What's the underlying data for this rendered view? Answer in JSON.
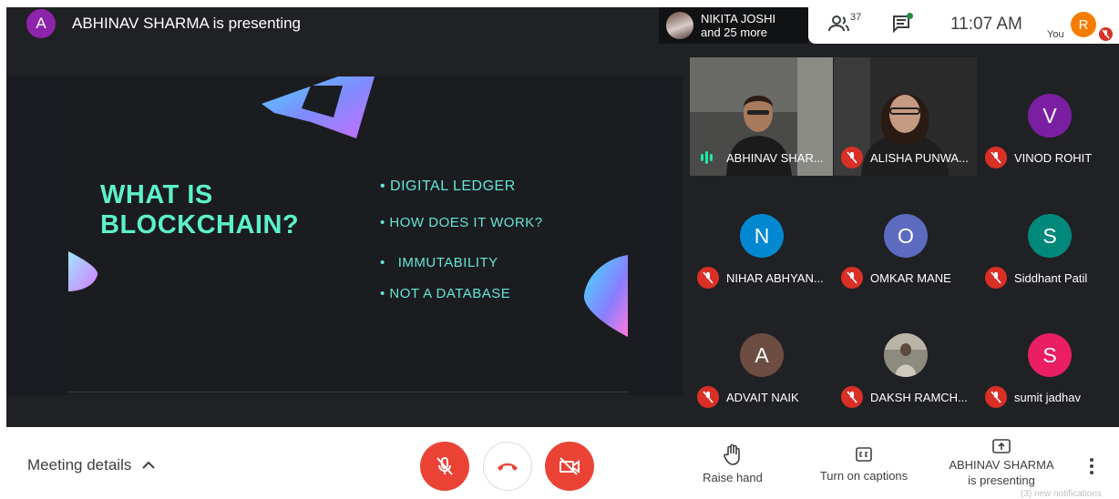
{
  "presenter": {
    "avatar_initial": "A",
    "banner_text": "ABHINAV SHARMA is presenting"
  },
  "top_chip": {
    "line1": "NIKITA JOSHI",
    "line2": "and 25 more"
  },
  "status": {
    "people_count": "37",
    "time": "11:07 AM",
    "you_label": "You",
    "you_initial": "R"
  },
  "slide": {
    "title_line1": "WHAT IS",
    "title_line2": "BLOCKCHAIN?",
    "bullets": [
      "• DIGITAL LEDGER",
      "• HOW DOES IT WORK?",
      "•   IMMUTABILITY",
      "• NOT A DATABASE"
    ]
  },
  "participants": [
    {
      "name": "ABHINAV SHAR...",
      "initial": "",
      "color": "",
      "muted": false,
      "speaking": true
    },
    {
      "name": "ALISHA PUNWA...",
      "initial": "",
      "color": "",
      "muted": true
    },
    {
      "name": "VINOD ROHIT",
      "initial": "V",
      "color": "#7b1fa2",
      "muted": true
    },
    {
      "name": "NIHAR ABHYAN...",
      "initial": "N",
      "color": "#0288d1",
      "muted": true
    },
    {
      "name": "OMKAR MANE",
      "initial": "O",
      "color": "#5c6bc0",
      "muted": true
    },
    {
      "name": "Siddhant Patil",
      "initial": "S",
      "color": "#00897b",
      "muted": true
    },
    {
      "name": "ADVAIT NAIK",
      "initial": "A",
      "color": "#6d4c41",
      "muted": true
    },
    {
      "name": "DAKSH RAMCH...",
      "initial": "",
      "color": "",
      "muted": true
    },
    {
      "name": "sumit jadhav",
      "initial": "S",
      "color": "#e91e63",
      "muted": true
    }
  ],
  "toolbar": {
    "meeting_details": "Meeting details",
    "raise_hand": "Raise hand",
    "captions": "Turn on captions",
    "presenting_line1": "ABHINAV SHARMA",
    "presenting_line2": "is presenting",
    "notifications": "(3) new notifications"
  }
}
